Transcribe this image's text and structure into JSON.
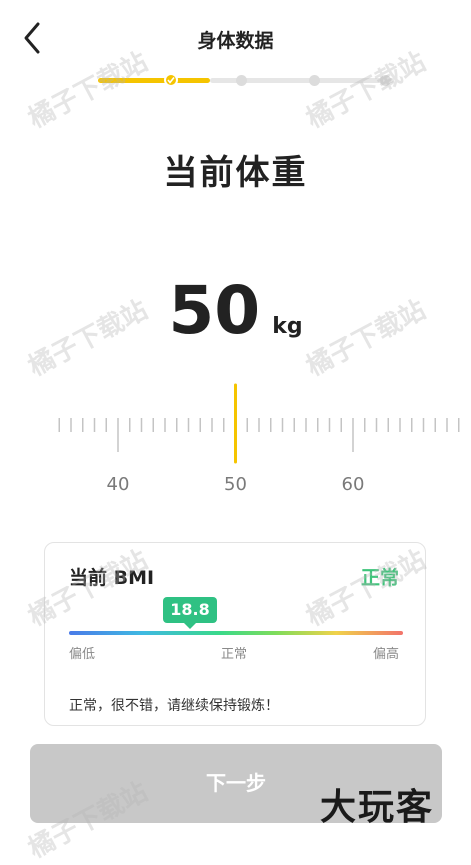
{
  "header": {
    "title": "身体数据",
    "back_icon": "chevron-left-icon"
  },
  "stepper": {
    "active_color": "#f5c400",
    "inactive_color": "#e6e6e6",
    "steps": [
      {
        "state": "done"
      },
      {
        "state": "pending"
      },
      {
        "state": "pending"
      },
      {
        "state": "pending"
      }
    ],
    "check_icon": "check-icon"
  },
  "main": {
    "heading": "当前体重"
  },
  "weight": {
    "value": "50",
    "unit": "kg"
  },
  "ruler": {
    "min": 35,
    "max": 74,
    "selected": 50,
    "step": 1,
    "major_every": 10,
    "labels": [
      "40",
      "50",
      "60"
    ],
    "indicator_color": "#f5c400"
  },
  "bmi": {
    "title": "当前 BMI",
    "status": "正常",
    "value": "18.8",
    "scale_low": "偏低",
    "scale_normal": "正常",
    "scale_high": "偏高",
    "message": "正常，很不错，请继续保持锻炼！",
    "status_color": "#3dc47a"
  },
  "footer": {
    "next_label": "下一步"
  },
  "watermark": {
    "text": "橘子下载站"
  },
  "corner_logo": {
    "text": "大玩客"
  }
}
